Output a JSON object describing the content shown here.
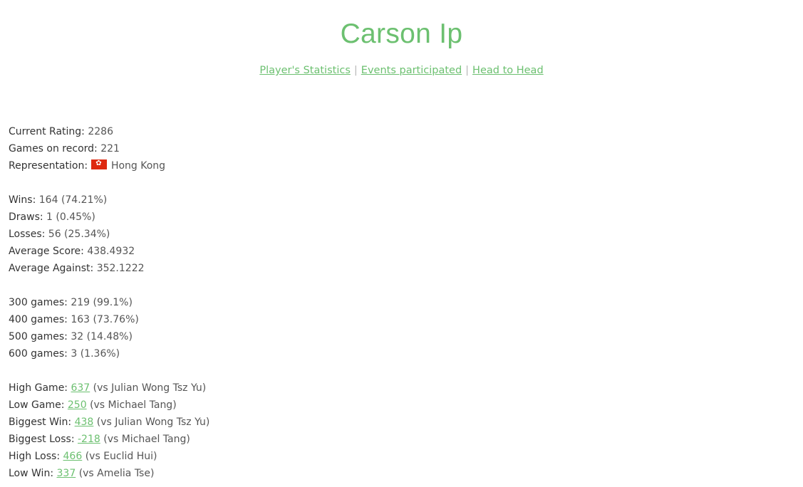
{
  "header": {
    "title": "Carson Ip",
    "nav": [
      {
        "label": "Player's Statistics"
      },
      {
        "label": "Events participated"
      },
      {
        "label": "Head to Head"
      }
    ],
    "separator": "|"
  },
  "profile": {
    "rating": {
      "label": "Current Rating:",
      "value": "2286"
    },
    "games": {
      "label": "Games on record:",
      "value": "221"
    },
    "representation": {
      "label": "Representation:",
      "flag_icon": "hong-kong-flag",
      "value": "Hong Kong"
    }
  },
  "record": [
    {
      "label": "Wins:",
      "value": "164 (74.21%)"
    },
    {
      "label": "Draws:",
      "value": "1 (0.45%)"
    },
    {
      "label": "Losses:",
      "value": "56 (25.34%)"
    },
    {
      "label": "Average Score:",
      "value": "438.4932"
    },
    {
      "label": "Average Against:",
      "value": "352.1222"
    }
  ],
  "thresholds": [
    {
      "label": "300 games:",
      "value": "219 (99.1%)"
    },
    {
      "label": "400 games:",
      "value": "163 (73.76%)"
    },
    {
      "label": "500 games:",
      "value": "32 (14.48%)"
    },
    {
      "label": "600 games:",
      "value": "3 (1.36%)"
    }
  ],
  "highlights": [
    {
      "label": "High Game:",
      "link": "637",
      "opponent": "(vs Julian Wong Tsz Yu)"
    },
    {
      "label": "Low Game:",
      "link": "250",
      "opponent": "(vs Michael Tang)"
    },
    {
      "label": "Biggest Win:",
      "link": "438",
      "opponent": "(vs Julian Wong Tsz Yu)"
    },
    {
      "label": "Biggest Loss:",
      "link": "-218",
      "opponent": "(vs Michael Tang)"
    },
    {
      "label": "High Loss:",
      "link": "466",
      "opponent": "(vs Euclid Hui)"
    },
    {
      "label": "Low Win:",
      "link": "337",
      "opponent": "(vs Amelia Tse)"
    }
  ],
  "colors": {
    "accent": "#6cc070",
    "flag_red": "#de2910"
  }
}
